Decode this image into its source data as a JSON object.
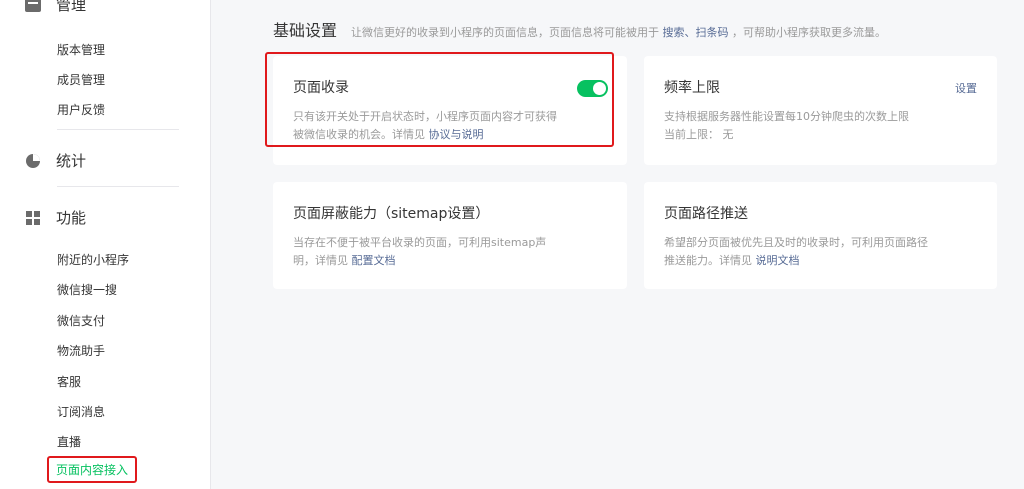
{
  "sidebar": {
    "groups": [
      {
        "label": "管理",
        "icon": "manage-icon"
      },
      {
        "label": "统计",
        "icon": "pie-chart-icon"
      },
      {
        "label": "功能",
        "icon": "grid-icon"
      }
    ],
    "manage_items": [
      "版本管理",
      "成员管理",
      "用户反馈"
    ],
    "function_items": [
      "附近的小程序",
      "微信搜一搜",
      "微信支付",
      "物流助手",
      "客服",
      "订阅消息",
      "直播",
      "页面内容接入"
    ],
    "active_item": "页面内容接入"
  },
  "main": {
    "title": "基础设置",
    "desc_prefix": "让微信更好的收录到小程序的页面信息，页面信息将可能被用于",
    "desc_link": "搜索、扫条码",
    "desc_suffix": "，可帮助小程序获取更多流量。",
    "cards": {
      "page_index": {
        "title": "页面收录",
        "toggle_on": true,
        "desc_line1": "只有该开关处于开启状态时，小程序页面内容才可获得",
        "desc_line2": "被微信收录的机会。详情见",
        "link": "协议与说明"
      },
      "frequency": {
        "title": "频率上限",
        "link": "设置",
        "desc_line1": "支持根据服务器性能设置每10分钟爬虫的次数上限",
        "desc_line2": "当前上限： 无"
      },
      "sitemap": {
        "title": "页面屏蔽能力（sitemap设置）",
        "desc_line1": "当存在不便于被平台收录的页面，可利用sitemap声",
        "desc_line2": "明，详情见",
        "link": "配置文档"
      },
      "path_push": {
        "title": "页面路径推送",
        "desc_line1": "希望部分页面被优先且及时的收录时，可利用页面路径",
        "desc_line2": "推送能力。详情见",
        "link": "说明文档"
      }
    }
  },
  "colors": {
    "accent": "#07c160",
    "link": "#576b95",
    "highlight": "#e0191c"
  }
}
